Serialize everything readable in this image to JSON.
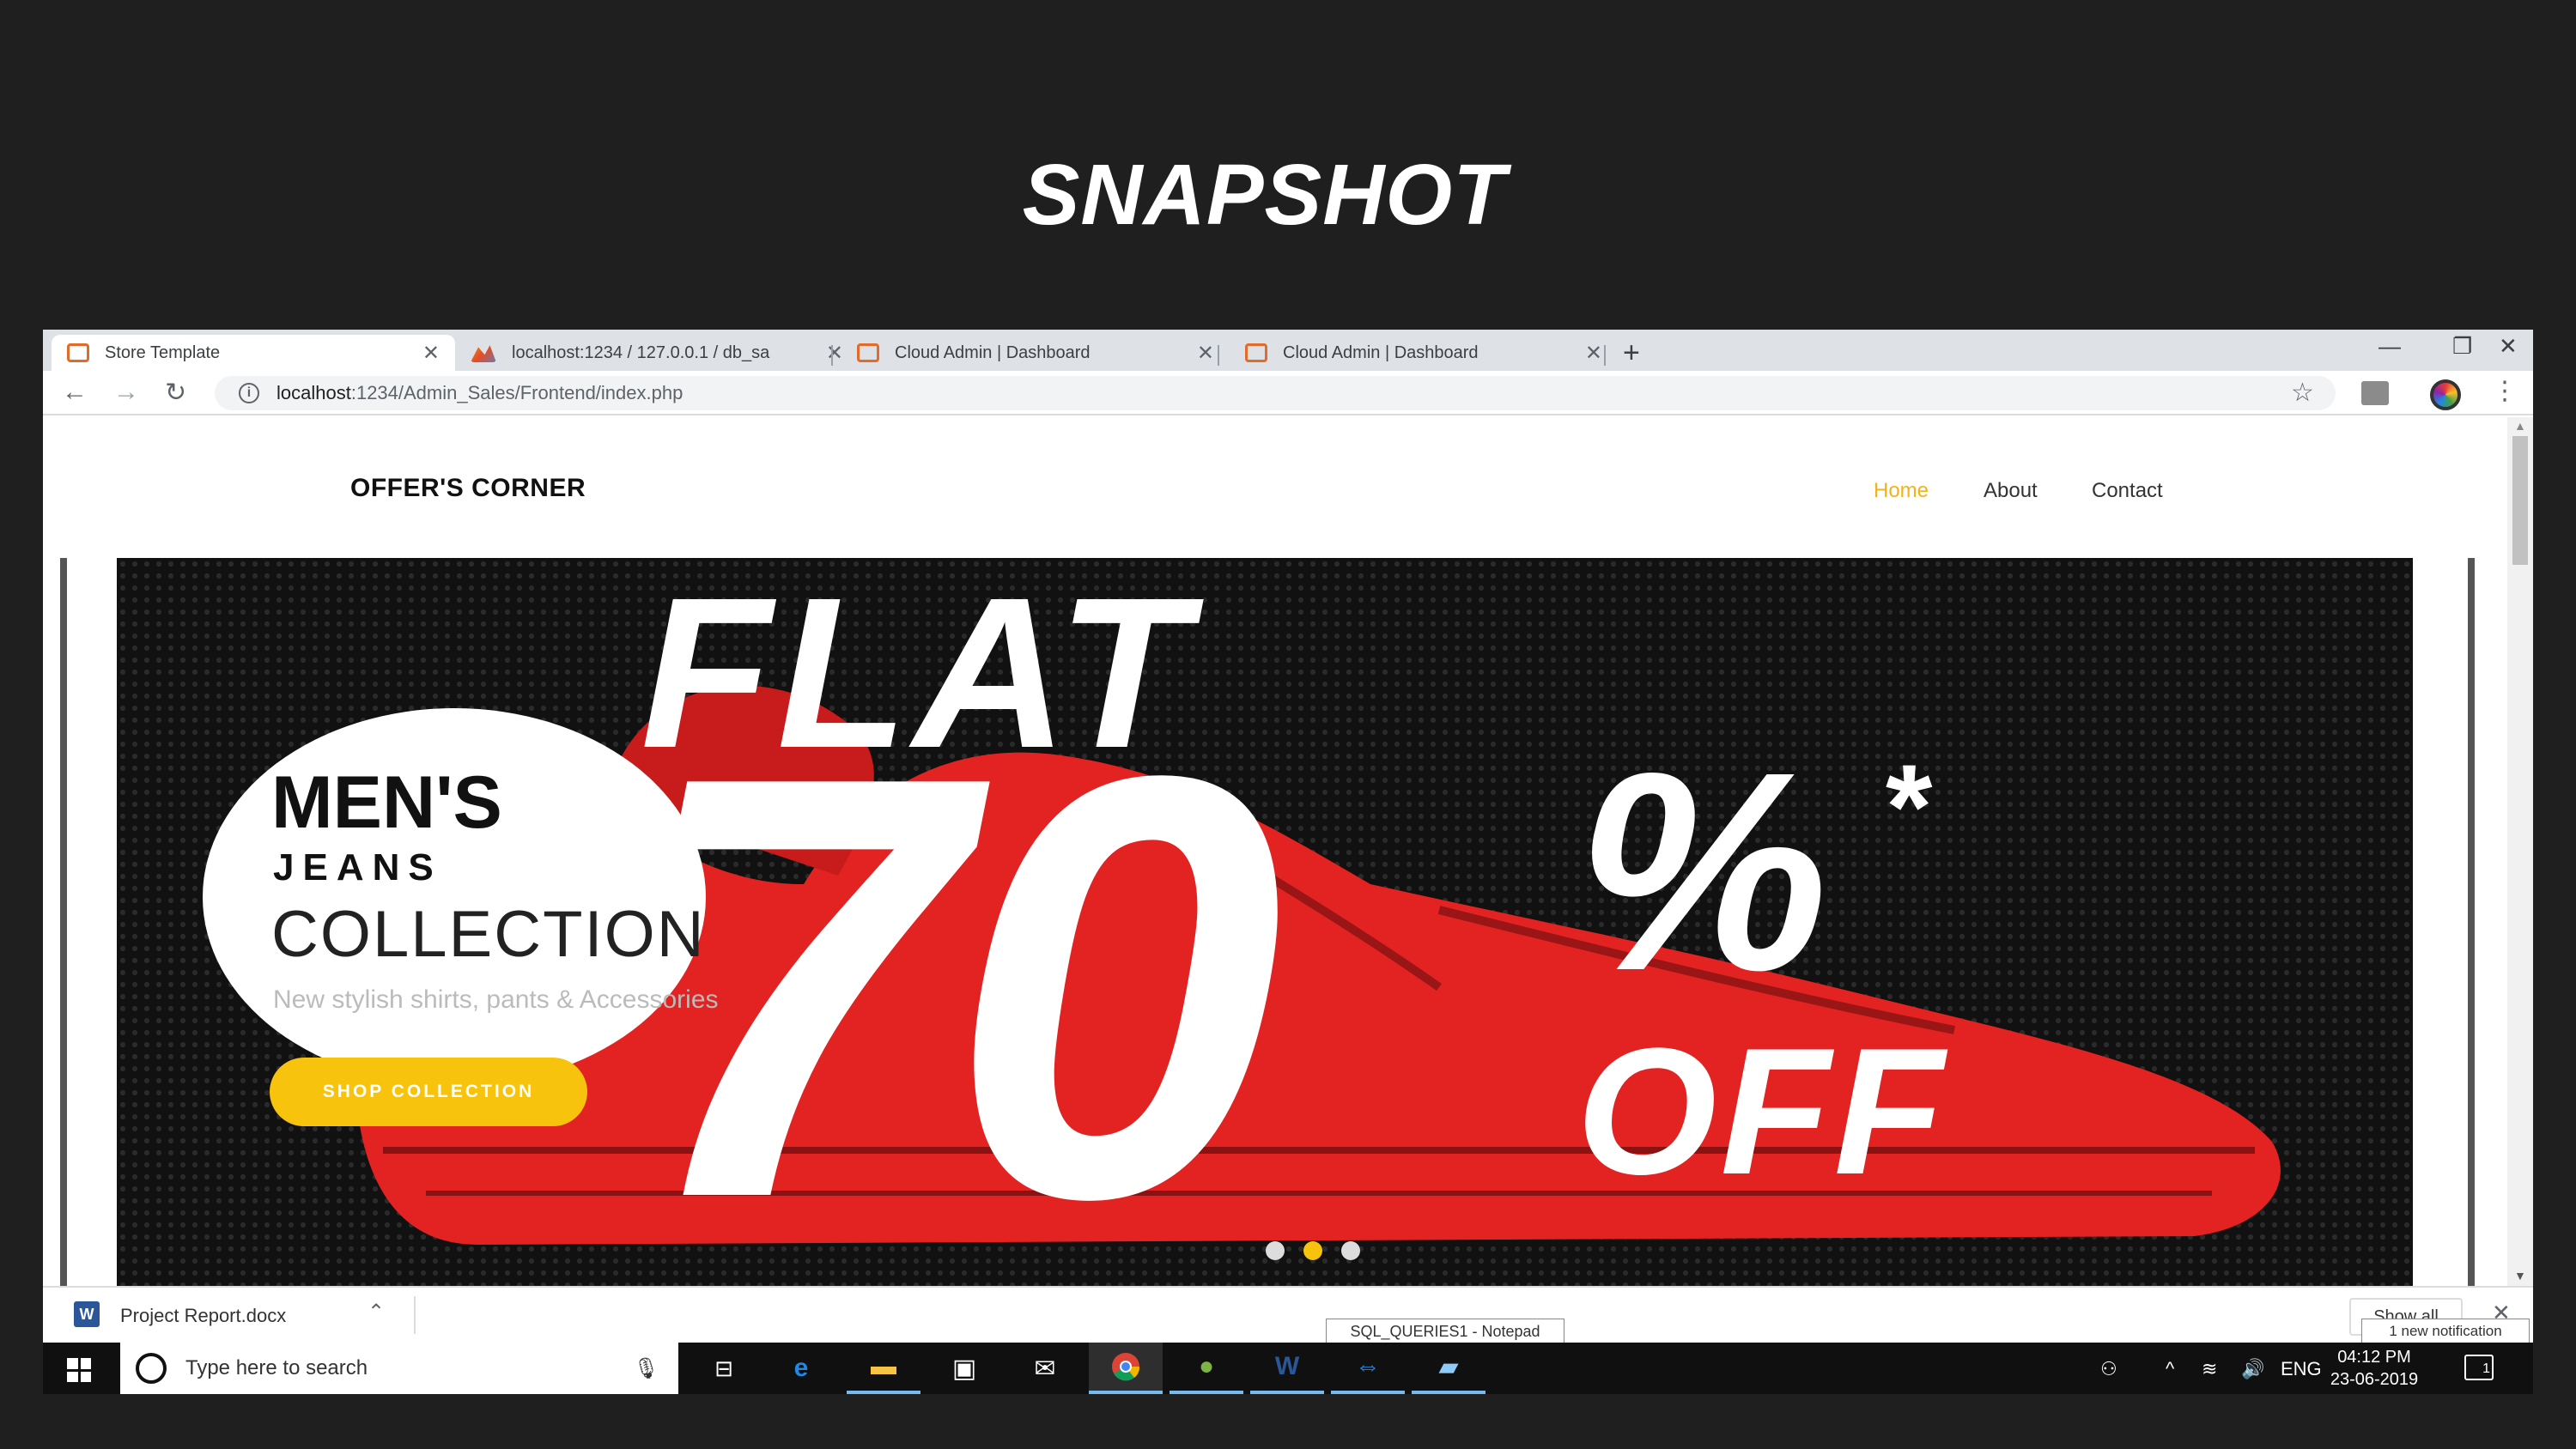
{
  "slide": {
    "title": "SNAPSHOT"
  },
  "browser": {
    "tabs": [
      {
        "label": "Store Template",
        "icon": "xampp-icon",
        "active": true
      },
      {
        "label": "localhost:1234 / 127.0.0.1 / db_sa",
        "icon": "phpmyadmin-icon",
        "active": false
      },
      {
        "label": "Cloud Admin | Dashboard",
        "icon": "xampp-icon",
        "active": false
      },
      {
        "label": "Cloud Admin | Dashboard",
        "icon": "xampp-icon",
        "active": false
      }
    ],
    "url_host": "localhost",
    "url_rest": ":1234/Admin_Sales/Frontend/index.php"
  },
  "site": {
    "brand": "OFFER'S CORNER",
    "nav": [
      "Home",
      "About",
      "Contact"
    ],
    "active_nav": "Home",
    "hero": {
      "banner_flat": "FLAT",
      "banner_value": "70",
      "banner_percent": "%",
      "banner_asterisk": "*",
      "banner_off": "OFF",
      "heading_1": "MEN'S",
      "heading_2": "JEANS",
      "heading_3": "COLLECTION",
      "subtitle": "New stylish shirts, pants & Accessories",
      "cta": "SHOP COLLECTION",
      "slides_total": 3,
      "active_slide": 2
    }
  },
  "downloads": {
    "file": "Project Report.docx",
    "show_all": "Show all"
  },
  "tooltips": {
    "notepad": "SQL_QUERIES1 - Notepad",
    "notification": "1 new notification"
  },
  "taskbar": {
    "search_placeholder": "Type here to search",
    "language": "ENG",
    "time": "04:12 PM",
    "date": "23-06-2019",
    "notification_count": "1"
  },
  "colors": {
    "accent": "#f8c30c",
    "nav_active": "#f3b21b",
    "banner_red": "#e32222",
    "slide_bg": "#1f1f1f"
  }
}
